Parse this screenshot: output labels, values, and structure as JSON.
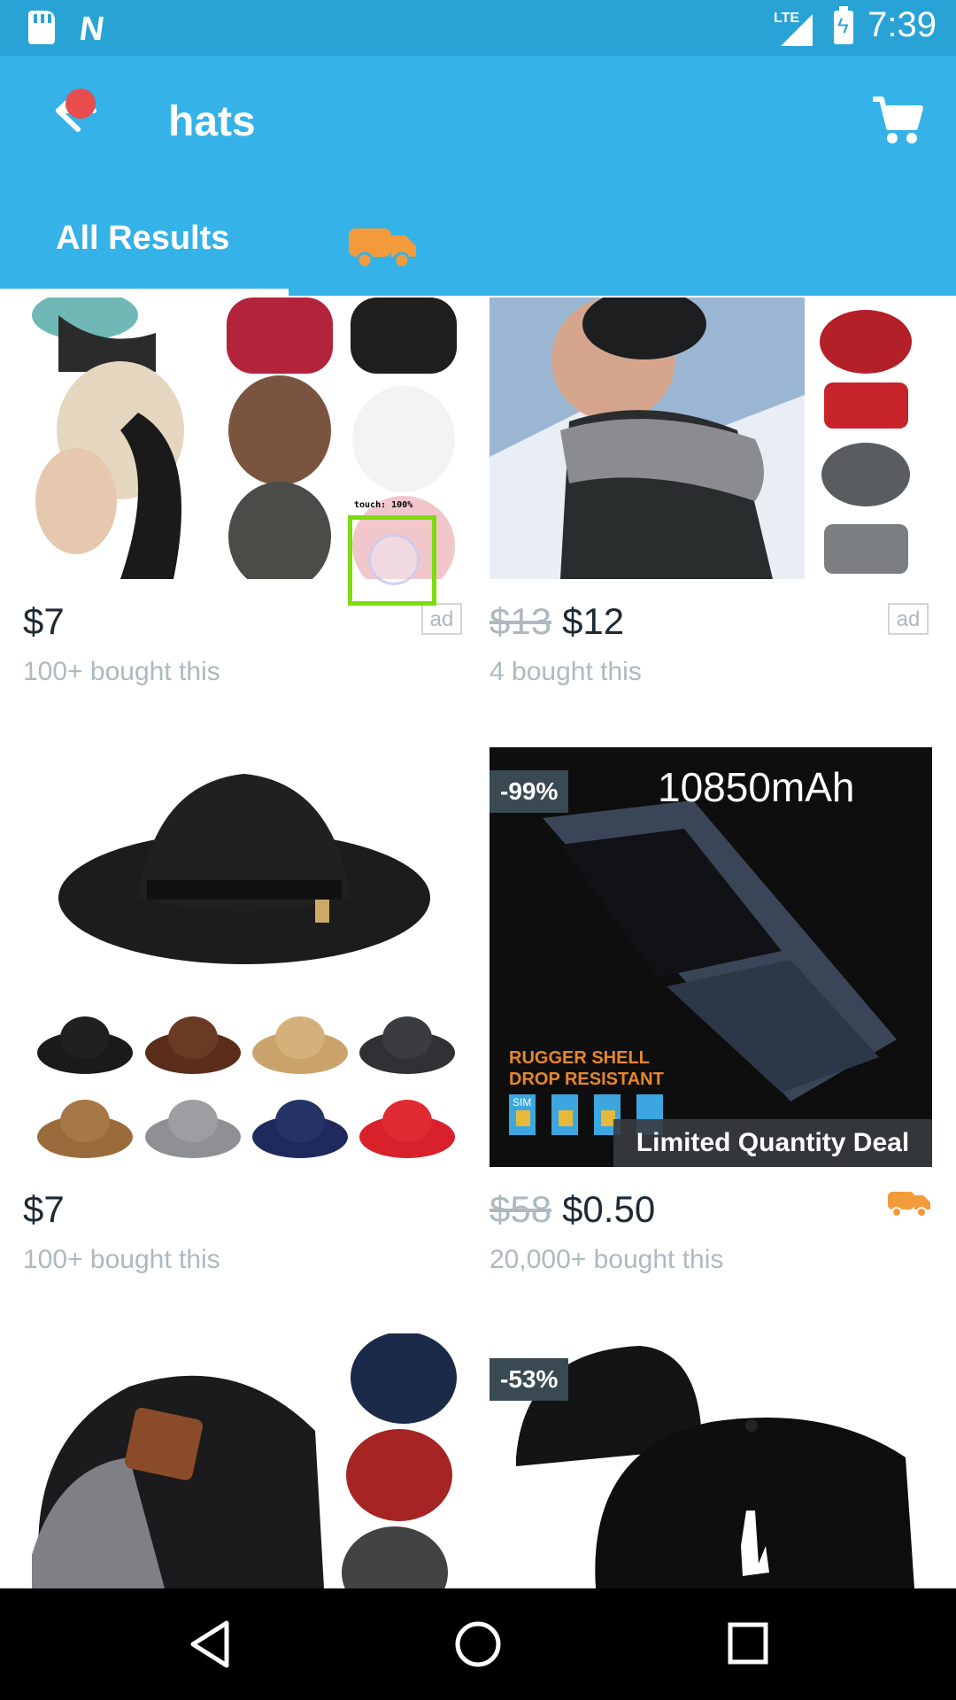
{
  "status_bar": {
    "network": "LTE",
    "time": "7:39"
  },
  "app_bar": {
    "title": "hats"
  },
  "tabs": [
    {
      "label": "All Results"
    }
  ],
  "products": [
    {
      "price": "$7",
      "sold": "100+ bought this",
      "badge": "ad"
    },
    {
      "old_price": "$13",
      "price": "$12",
      "sold": "4 bought this",
      "badge": "ad"
    },
    {
      "price": "$7",
      "sold": "100+ bought this"
    },
    {
      "old_price": "$58",
      "price": "$0.50",
      "sold": "20,000+ bought this",
      "discount": "-99%",
      "image_text": {
        "capacity": "10850mAh",
        "tagline1": "RUGGER SHELL",
        "tagline2": "DROP RESISTANT",
        "sim": "SIM",
        "deal": "Limited Quantity Deal"
      }
    },
    {
      "price": "",
      "sold": ""
    },
    {
      "discount": "-53%",
      "price": "",
      "sold": ""
    }
  ],
  "touch_overlay": {
    "label": "touch: 100%"
  },
  "colors": {
    "status_bar": "#29A3D6",
    "app_bar": "#35B2E8",
    "notification": "#E84C4C",
    "shipping": "#F39A3B"
  }
}
